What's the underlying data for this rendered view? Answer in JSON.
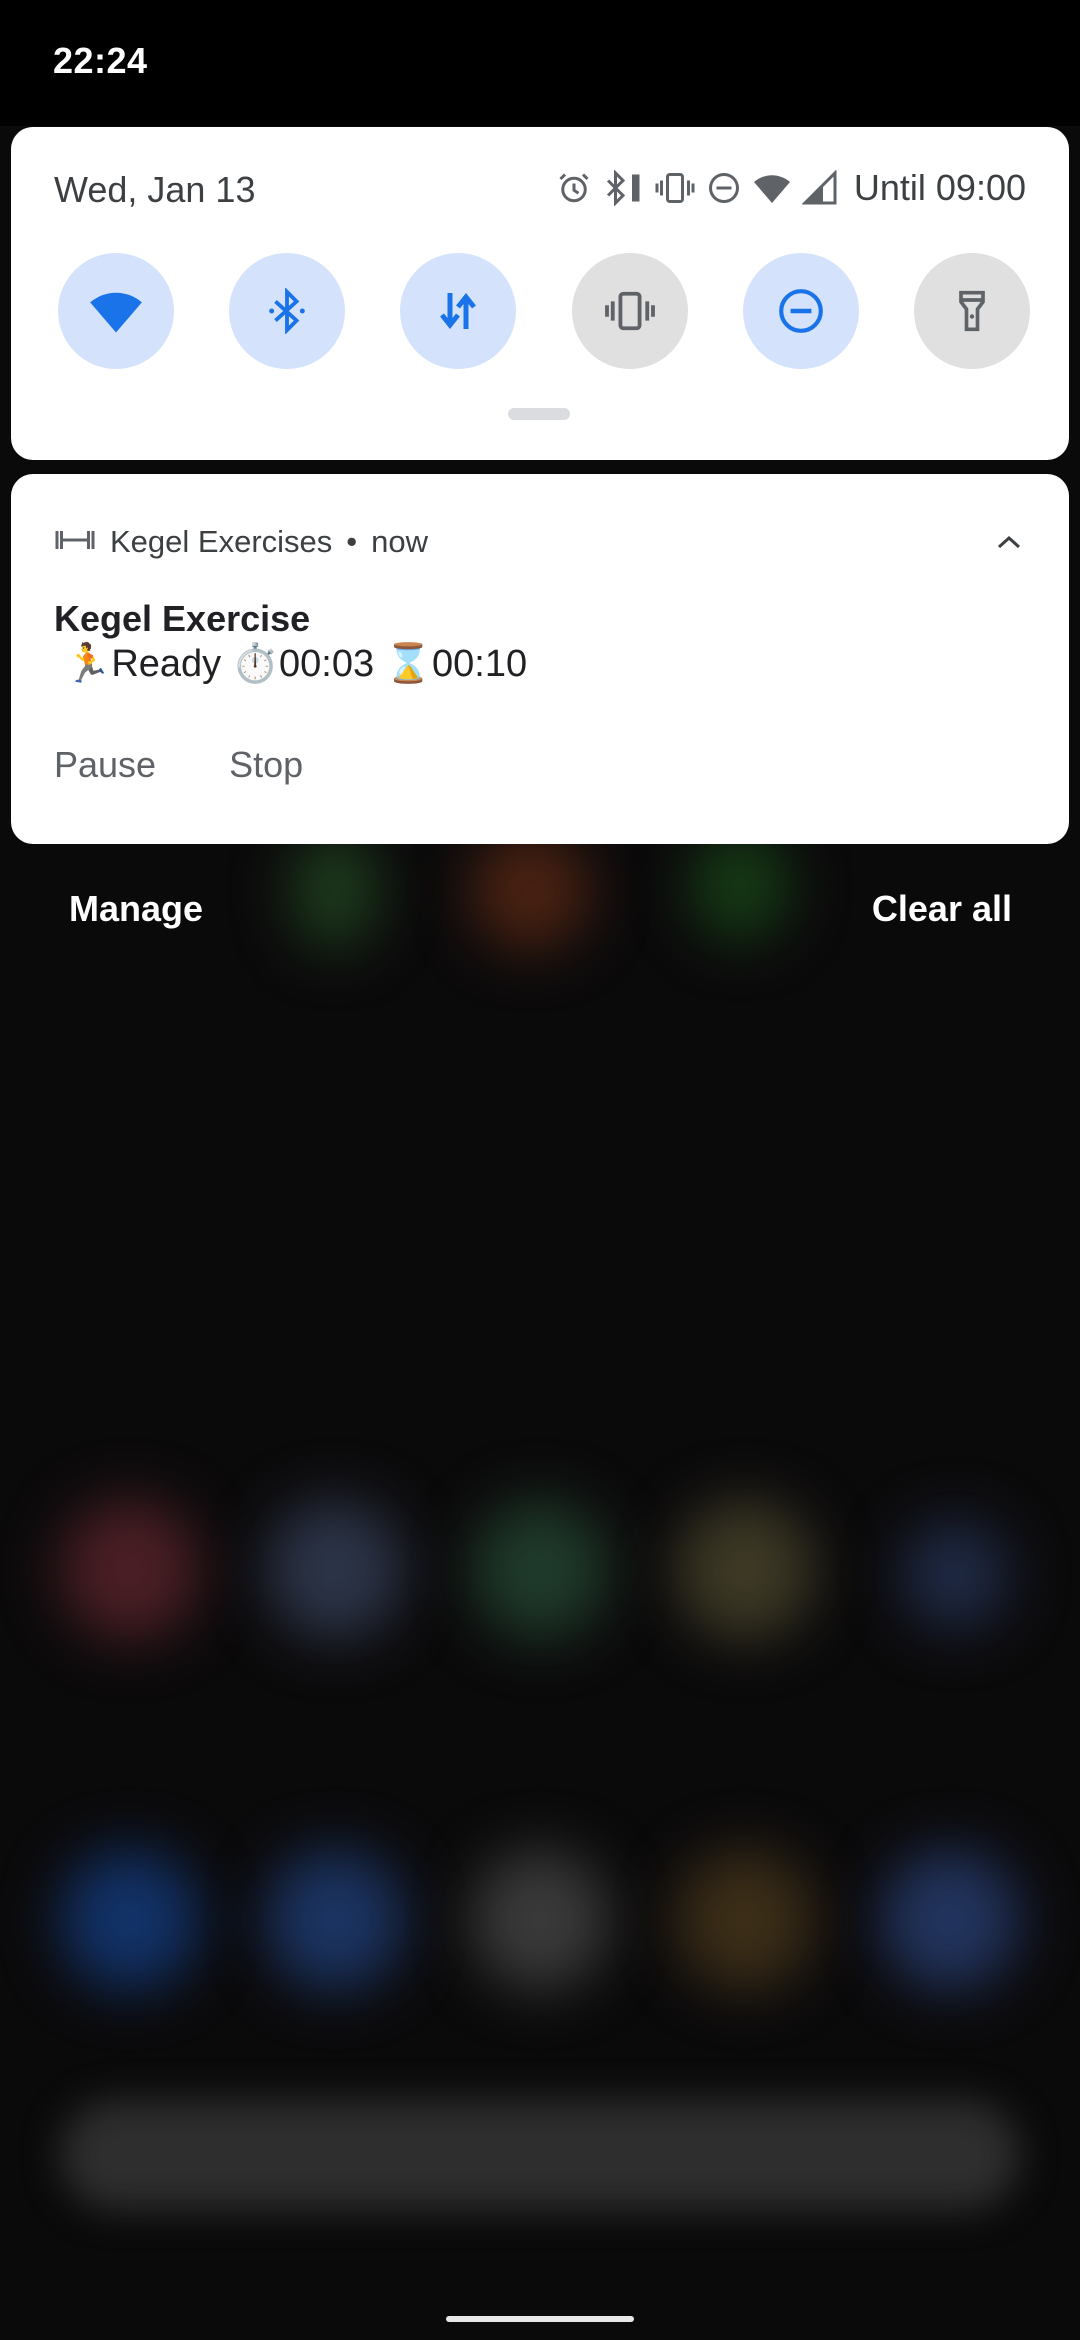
{
  "status_bar": {
    "time": "22:24"
  },
  "quick_settings": {
    "date": "Wed, Jan 13",
    "until": "Until 09:00",
    "status_icons": [
      "alarm-icon",
      "bluetooth-battery-icon",
      "vibrate-icon",
      "dnd-icon",
      "wifi-icon",
      "signal-icon"
    ],
    "tiles": [
      {
        "name": "wifi",
        "state": "on"
      },
      {
        "name": "bluetooth",
        "state": "on"
      },
      {
        "name": "mobile-data",
        "state": "on"
      },
      {
        "name": "vibrate",
        "state": "off"
      },
      {
        "name": "do-not-disturb",
        "state": "on"
      },
      {
        "name": "flashlight",
        "state": "off"
      }
    ],
    "accent_color": "#1a73e8"
  },
  "notification": {
    "app_name": "Kegel Exercises",
    "separator": "•",
    "time": "now",
    "title": "Kegel Exercise",
    "text": "🏃Ready ⏱️00:03 ⌛00:10",
    "actions": [
      "Pause",
      "Stop"
    ]
  },
  "footer": {
    "manage": "Manage",
    "clear_all": "Clear all"
  }
}
